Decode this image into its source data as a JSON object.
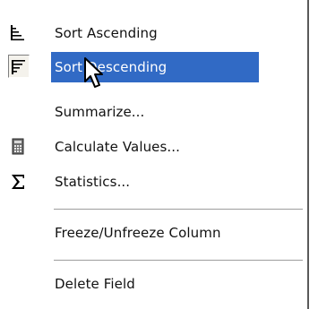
{
  "menu": {
    "items": [
      {
        "label": "Sort Ascending",
        "icon": "sort-ascending-icon"
      },
      {
        "label": "Sort Descending",
        "icon": "sort-descending-icon",
        "selected": true
      },
      {
        "label": "Summarize..."
      },
      {
        "label": "Calculate Values...",
        "icon": "calculator-icon"
      },
      {
        "label": "Statistics...",
        "icon": "sigma-icon"
      },
      {
        "label": "Freeze/Unfreeze Column"
      },
      {
        "label": "Delete Field"
      }
    ]
  },
  "colors": {
    "highlight": "#316ac5",
    "text": "#111111",
    "highlight_text": "#ffffff"
  }
}
